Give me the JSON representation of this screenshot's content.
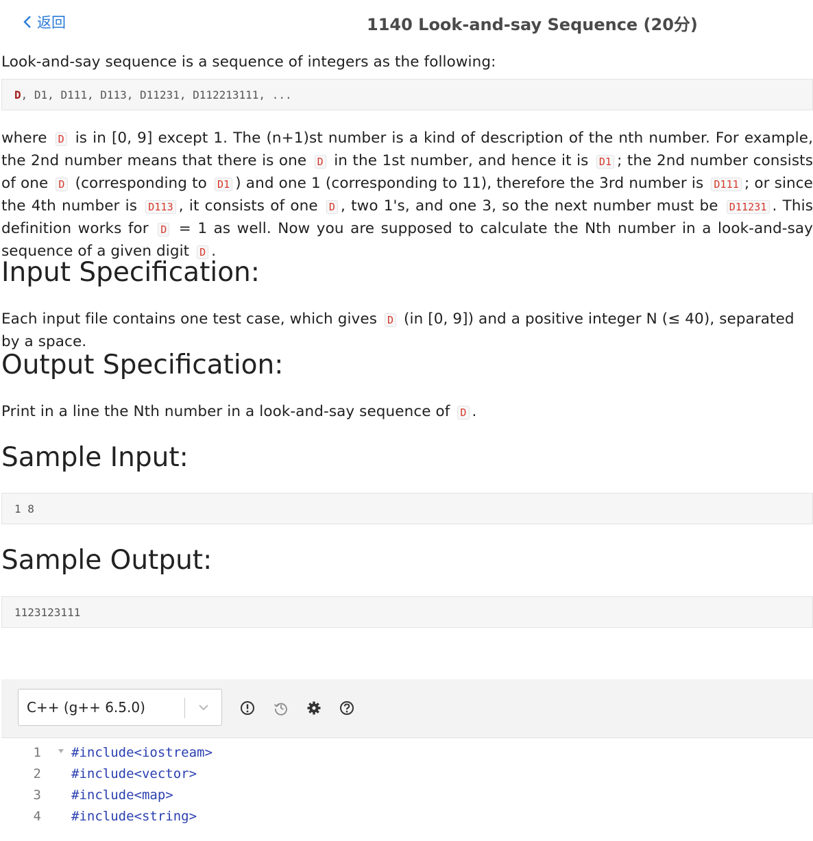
{
  "header": {
    "back_label": "返回",
    "title": "1140 Look-and-say Sequence (20分)"
  },
  "problem": {
    "intro": "Look-and-say sequence is a sequence of integers as the following:",
    "sequence_first": "D",
    "sequence_rest": ", D1, D111, D113, D11231, D112213111, ...",
    "desc": {
      "t1": "where",
      "c1": "D",
      "t2": "is in [0, 9] except 1. The (n+1)st number is a kind of description of the nth number. For example, the 2nd number means that there is one",
      "c2": "D",
      "t3": "in the 1st number, and hence it is",
      "c3": "D1",
      "t4": "; the 2nd number consists of one",
      "c4": "D",
      "t5": "(corresponding to",
      "c5": "D1",
      "t6": ") and one 1 (corresponding to 11), therefore the 3rd number is",
      "c6": "D111",
      "t7": "; or since the 4th number is",
      "c7": "D113",
      "t8": ", it consists of one",
      "c8": "D",
      "t9": ", two 1's, and one 3, so the next number must be",
      "c9": "D11231",
      "t10": ". This definition works for",
      "c10": "D",
      "t11": "= 1 as well. Now you are supposed to calculate the Nth number in a look-and-say sequence of a given digit",
      "c11": "D",
      "t12": "."
    },
    "input_heading": "Input Specification:",
    "input": {
      "t1": "Each input file contains one test case, which gives",
      "c1": "D",
      "t2": "(in [0, 9]) and a positive integer N (≤ 40), separated by a space."
    },
    "output_heading": "Output Specification:",
    "output": {
      "t1": "Print in a line the Nth number in a look-and-say sequence of",
      "c1": "D",
      "t2": "."
    },
    "sample_input_heading": "Sample Input:",
    "sample_input": "1 8",
    "sample_output_heading": "Sample Output:",
    "sample_output": "1123123111"
  },
  "editor": {
    "language": "C++ (g++ 6.5.0)",
    "tools": [
      "info-icon",
      "history-icon",
      "gear-icon",
      "help-icon"
    ],
    "lines": [
      {
        "num": "1",
        "text": "#include<iostream>"
      },
      {
        "num": "2",
        "text": "#include<vector>"
      },
      {
        "num": "3",
        "text": "#include<map>"
      },
      {
        "num": "4",
        "text": "#include<string>"
      }
    ]
  },
  "colors": {
    "link": "#2b7bd8",
    "inline_code": "#d5392e",
    "code_keyword": "#2a3fb0"
  }
}
